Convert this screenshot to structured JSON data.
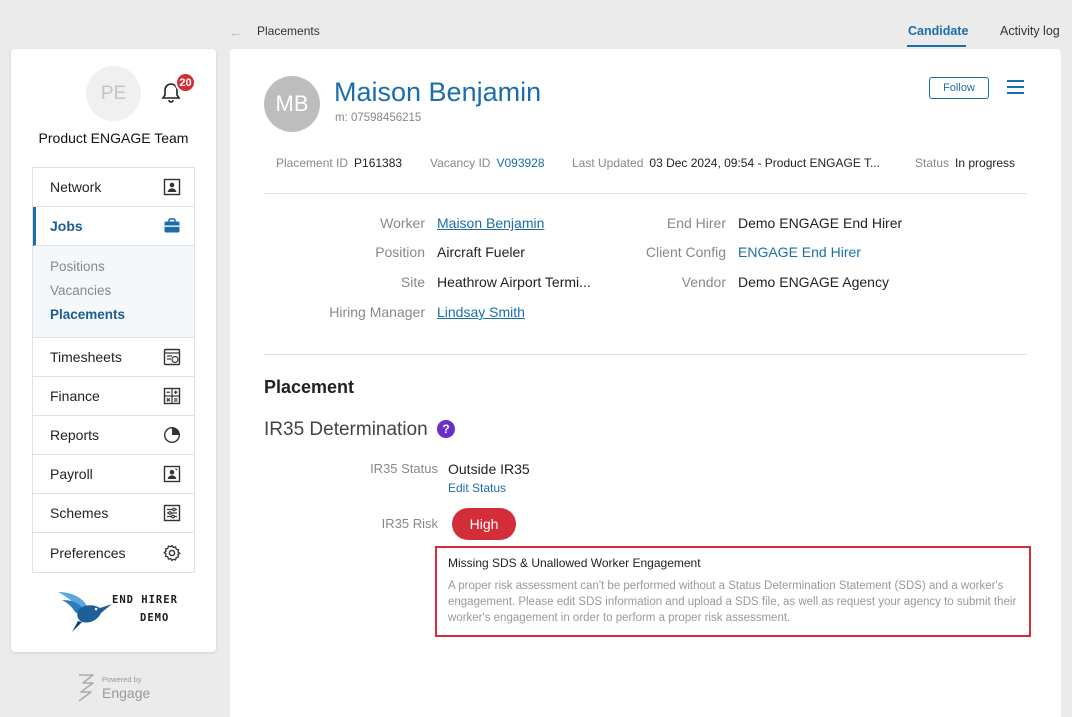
{
  "sidebar": {
    "avatar_initials": "PE",
    "notification_count": "20",
    "team_name": "Product ENGAGE Team",
    "nav": [
      {
        "label": "Network"
      },
      {
        "label": "Jobs"
      },
      {
        "label": "Timesheets"
      },
      {
        "label": "Finance"
      },
      {
        "label": "Reports"
      },
      {
        "label": "Payroll"
      },
      {
        "label": "Schemes"
      },
      {
        "label": "Preferences"
      }
    ],
    "jobs_sub": [
      {
        "label": "Positions"
      },
      {
        "label": "Vacancies"
      },
      {
        "label": "Placements"
      }
    ],
    "logo_line1": "END HIRER",
    "logo_line2": "DEMO",
    "powered_by": "Powered by",
    "powered_brand": "Engage"
  },
  "topbar": {
    "breadcrumb": "Placements",
    "tabs": [
      {
        "label": "Candidate"
      },
      {
        "label": "Activity log"
      }
    ]
  },
  "candidate": {
    "initials": "MB",
    "name": "Maison Benjamin",
    "mobile": "m: 07598456215",
    "follow_label": "Follow"
  },
  "meta": {
    "placement_id_label": "Placement ID",
    "placement_id": "P161383",
    "vacancy_id_label": "Vacancy ID",
    "vacancy_id": "V093928",
    "last_updated_label": "Last Updated",
    "last_updated": "03 Dec 2024, 09:54 - Product ENGAGE T...",
    "status_label": "Status",
    "status": "In progress"
  },
  "details": {
    "worker_label": "Worker",
    "worker": "Maison Benjamin",
    "position_label": "Position",
    "position": "Aircraft Fueler",
    "site_label": "Site",
    "site": "Heathrow Airport Termi...",
    "hiring_manager_label": "Hiring Manager",
    "hiring_manager": "Lindsay Smith",
    "end_hirer_label": "End Hirer",
    "end_hirer": "Demo ENGAGE End Hirer",
    "client_config_label": "Client Config",
    "client_config": "ENGAGE End Hirer",
    "vendor_label": "Vendor",
    "vendor": "Demo ENGAGE Agency"
  },
  "placement": {
    "section_title": "Placement",
    "ir35_title": "IR35 Determination",
    "help_glyph": "?",
    "ir35_status_label": "IR35 Status",
    "ir35_status": "Outside IR35",
    "edit_status_label": "Edit Status",
    "ir35_risk_label": "IR35 Risk",
    "ir35_risk": "High",
    "alert_title": "Missing SDS & Unallowed Worker Engagement",
    "alert_body": "A proper risk assessment can't be performed without a Status Determination Statement (SDS) and a worker's engagement. Please edit SDS information and upload a SDS file, as well as request your agency to submit their worker's engagement in order to perform a proper risk assessment."
  },
  "colors": {
    "primary": "#1a6ea9",
    "danger": "#d42d3a",
    "help": "#6b2fc9"
  }
}
